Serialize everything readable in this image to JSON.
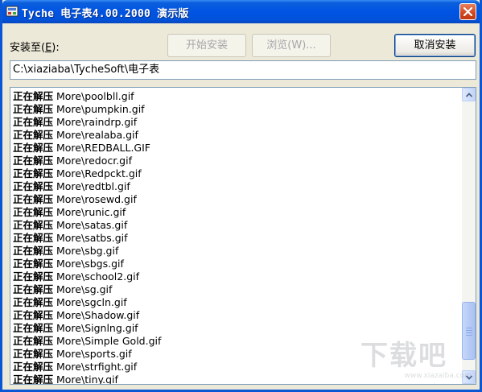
{
  "window": {
    "title": "Tyche 电子表4.00.2000 演示版"
  },
  "toolbar": {
    "install_to_label": "安装至(",
    "install_to_hotkey": "E",
    "install_to_suffix": "):",
    "start_install": "开始安装",
    "browse": "浏览(W)...",
    "cancel_install": "取消安装"
  },
  "path": {
    "value": "C:\\xiaziaba\\TycheSoft\\电子表"
  },
  "log": {
    "verb": "正在解压",
    "lines": [
      "More\\poolbll.gif",
      "More\\pumpkin.gif",
      "More\\raindrp.gif",
      "More\\realaba.gif",
      "More\\REDBALL.GIF",
      "More\\redocr.gif",
      "More\\Redpckt.gif",
      "More\\redtbl.gif",
      "More\\rosewd.gif",
      "More\\runic.gif",
      "More\\satas.gif",
      "More\\satbs.gif",
      "More\\sbg.gif",
      "More\\sbgs.gif",
      "More\\school2.gif",
      "More\\sg.gif",
      "More\\sgcln.gif",
      "More\\Shadow.gif",
      "More\\Signlng.gif",
      "More\\Simple Gold.gif",
      "More\\sports.gif",
      "More\\strfight.gif",
      "More\\tiny.gif"
    ],
    "scroll_position": 0.95
  },
  "watermark": {
    "text": "下载吧",
    "url": "www.xiazaiba.com"
  },
  "colors": {
    "titlebar": "#0054e3",
    "window_bg": "#ece9d8",
    "close_button": "#d0461e"
  }
}
